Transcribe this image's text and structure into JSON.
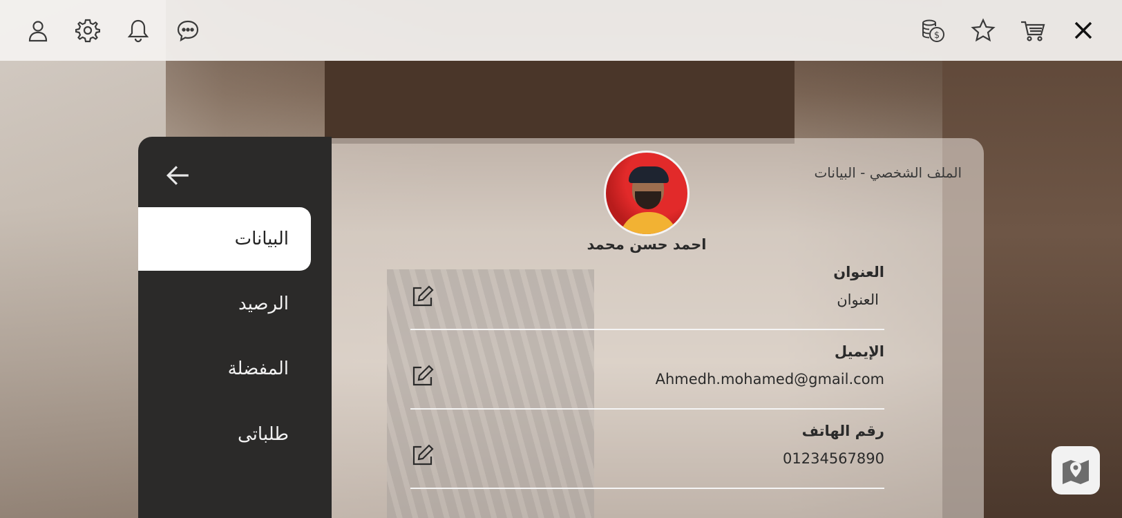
{
  "topbar": {
    "icons": [
      "user-icon",
      "settings-icon",
      "bell-icon",
      "chat-icon",
      "coins-icon",
      "star-icon",
      "cart-icon",
      "close-icon"
    ]
  },
  "sidebar": {
    "items": [
      {
        "label": "البيانات",
        "active": true
      },
      {
        "label": "الرصيد",
        "active": false
      },
      {
        "label": "المفضلة",
        "active": false
      },
      {
        "label": "طلباتى",
        "active": false
      }
    ]
  },
  "profile": {
    "breadcrumb": "الملف الشخصي - البيانات",
    "name": "احمد حسن محمد",
    "fields": [
      {
        "label": "العنوان",
        "value": "العنوان"
      },
      {
        "label": "الإيميل",
        "value": "Ahmedh.mohamed@gmail.com"
      },
      {
        "label": "رقم الهاتف",
        "value": "01234567890"
      }
    ]
  },
  "colors": {
    "sidebar_bg": "#2b2a29",
    "active_item_bg": "#ffffff",
    "text_dark": "#2a2a2a"
  }
}
